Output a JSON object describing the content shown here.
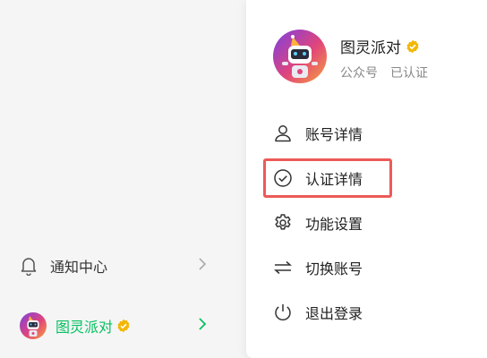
{
  "sidebar": {
    "notifications_label": "通知中心",
    "account_label": "图灵派对"
  },
  "profile": {
    "name": "图灵派对",
    "type": "公众号",
    "status": "已认证"
  },
  "menu": {
    "items": [
      {
        "label": "账号详情",
        "icon": "user-icon"
      },
      {
        "label": "认证详情",
        "icon": "check-circle-icon"
      },
      {
        "label": "功能设置",
        "icon": "gear-icon"
      },
      {
        "label": "切换账号",
        "icon": "switch-arrows-icon"
      },
      {
        "label": "退出登录",
        "icon": "power-icon"
      }
    ]
  },
  "colors": {
    "accent_green": "#07c160",
    "verified_gold": "#f2b705",
    "highlight_red": "#ec5a57"
  }
}
